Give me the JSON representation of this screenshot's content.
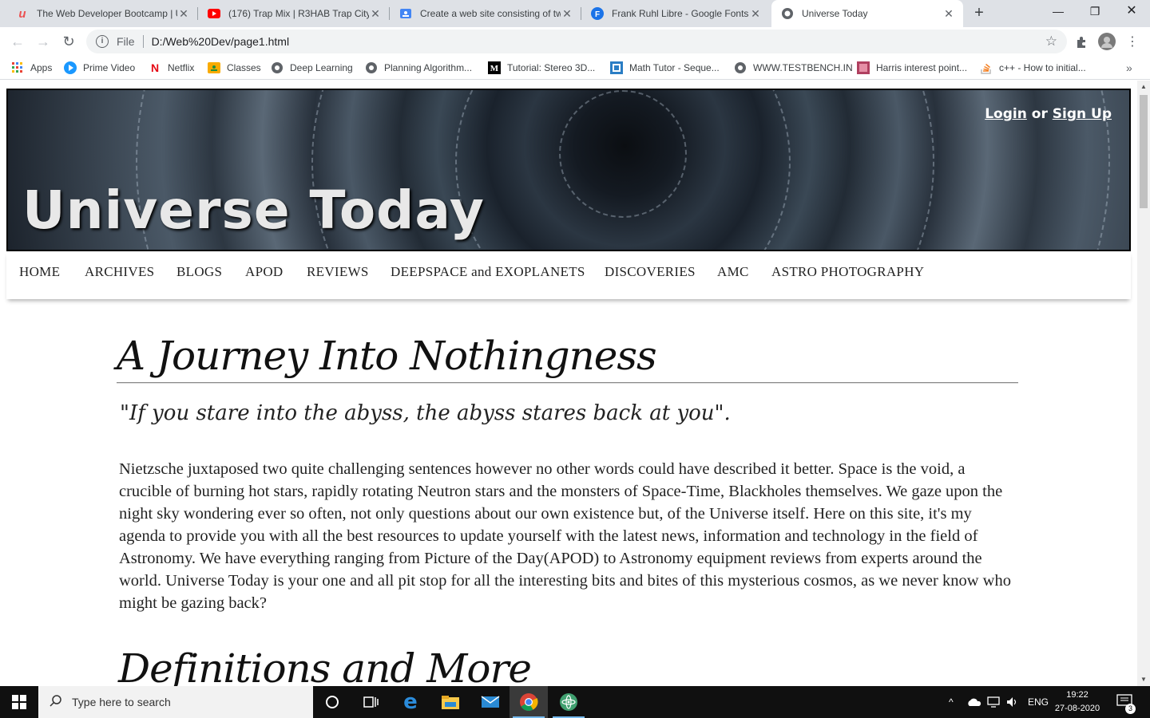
{
  "browser": {
    "tabs": [
      {
        "title": "The Web Developer Bootcamp | U",
        "icon": "udemy-icon",
        "color": "#ec5252"
      },
      {
        "title": "(176) Trap Mix | R3HAB Trap City",
        "icon": "youtube-icon",
        "color": "#ff0000"
      },
      {
        "title": "Create a web site consisting of tw",
        "icon": "classroom-icon",
        "color": "#4285f4"
      },
      {
        "title": "Frank Ruhl Libre - Google Fonts",
        "icon": "google-fonts-icon",
        "color": "#1a73e8"
      },
      {
        "title": "Universe Today",
        "icon": "globe-icon",
        "color": "#5f6368"
      }
    ],
    "address": {
      "scheme": "File",
      "url": "D:/Web%20Dev/page1.html"
    },
    "bookmarks": [
      {
        "label": "Apps",
        "icon": "apps-grid-icon"
      },
      {
        "label": "Prime Video",
        "icon": "prime-video-icon"
      },
      {
        "label": "Netflix",
        "icon": "netflix-icon"
      },
      {
        "label": "Classes",
        "icon": "classroom-icon"
      },
      {
        "label": "Deep Learning",
        "icon": "globe-icon"
      },
      {
        "label": "Planning Algorithm...",
        "icon": "globe-icon"
      },
      {
        "label": "Tutorial: Stereo 3D...",
        "icon": "medium-icon"
      },
      {
        "label": "Math Tutor - Seque...",
        "icon": "math-tutor-icon"
      },
      {
        "label": "WWW.TESTBENCH.IN",
        "icon": "globe-icon"
      },
      {
        "label": "Harris interest point...",
        "icon": "image-icon"
      },
      {
        "label": "c++ - How to initial...",
        "icon": "stackoverflow-icon"
      }
    ]
  },
  "page": {
    "site_title": "Universe Today",
    "auth": {
      "login": "Login",
      "or": "or",
      "signup": "Sign Up"
    },
    "nav": [
      "HOME",
      "ARCHIVES",
      "BLOGS",
      "APOD",
      "REVIEWS",
      "DEEPSPACE and EXOPLANETS",
      "DISCOVERIES",
      "AMC",
      "ASTRO PHOTOGRAPHY"
    ],
    "heading": "A Journey Into Nothingness",
    "quote": "\"If you stare into the abyss, the abyss stares back at you\".",
    "paragraph": "Nietzsche juxtaposed two quite challenging sentences however no other words could have described it better. Space is the void, a crucible of burning hot stars, rapidly rotating Neutron stars and the monsters of Space-Time, Blackholes themselves. We gaze upon the night sky wondering ever so often, not only questions about our own existence but, of the Universe itself. Here on this site, it's my agenda to provide you with all the best resources to update yourself with the latest news, information and technology in the field of Astronomy. We have everything ranging from Picture of the Day(APOD) to Astronomy equipment reviews from experts around the world. Universe Today is your one and all pit stop for all the interesting bits and bites of this mysterious cosmos, as we never know who might be gazing back?",
    "heading2": "Definitions and More"
  },
  "taskbar": {
    "search_placeholder": "Type here to search",
    "language": "ENG",
    "time": "19:22",
    "date": "27-08-2020",
    "notification_count": "3"
  }
}
